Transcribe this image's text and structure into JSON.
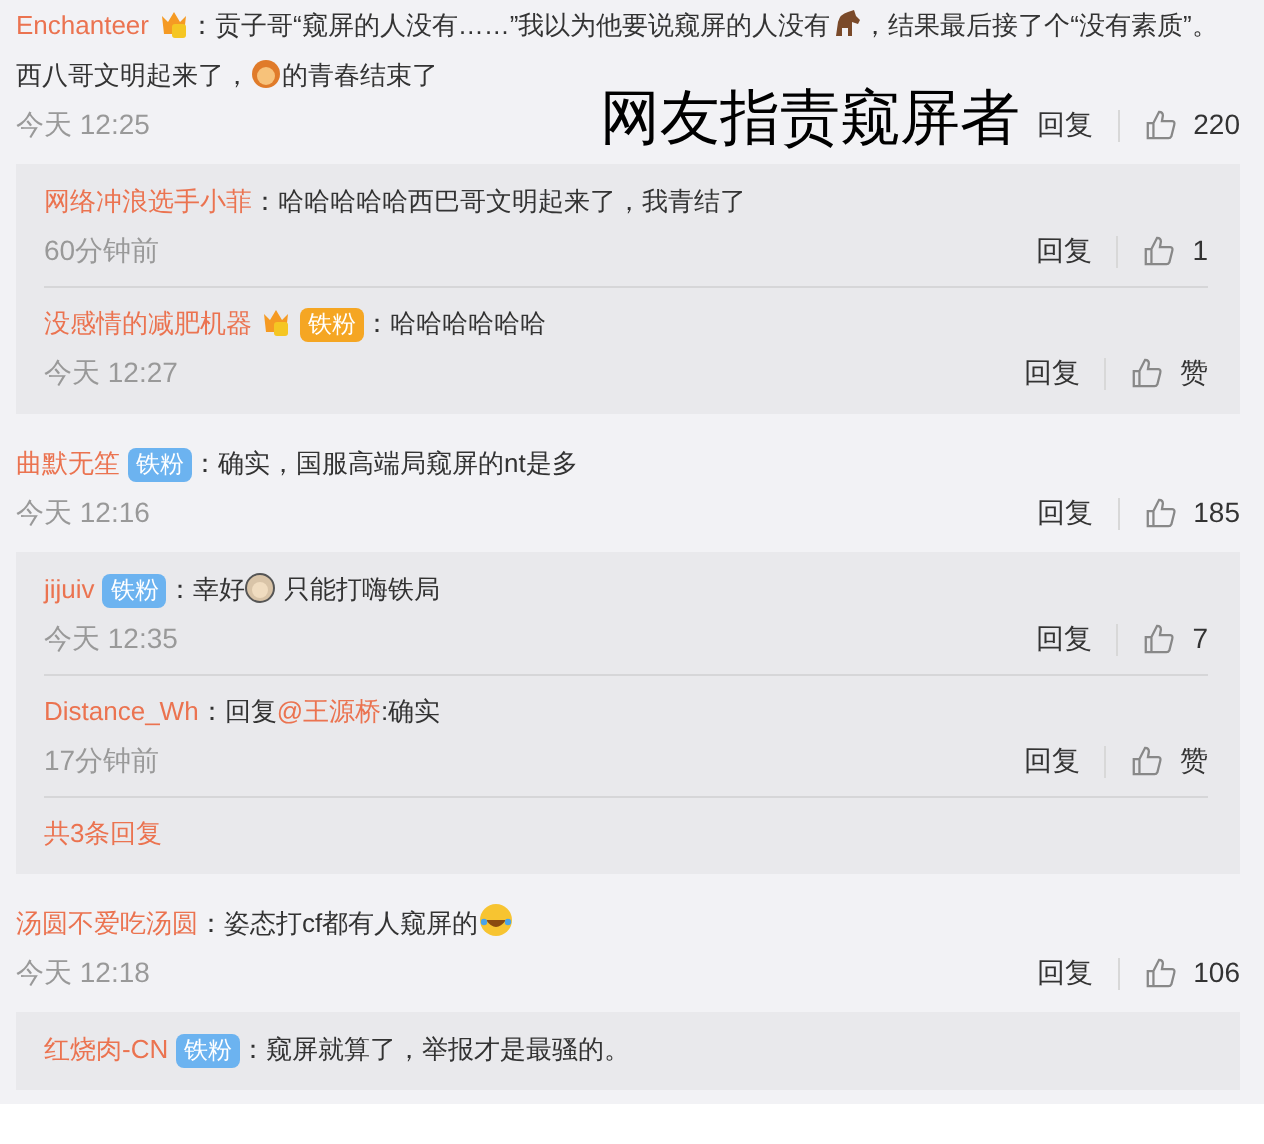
{
  "caption": "网友指责窥屏者",
  "comments": [
    {
      "user": "Enchanteer",
      "badges": [
        {
          "kind": "vip"
        }
      ],
      "parts": [
        {
          "kind": "text",
          "text": "：贡子哥“窥屏的人没有……”我以为他要说窥屏的人没有"
        },
        {
          "kind": "horse"
        },
        {
          "kind": "text",
          "text": "，结果最后接了个“没有素质”。西八哥文明起来了，"
        },
        {
          "kind": "face"
        },
        {
          "kind": "text",
          "text": "的青春结束了"
        }
      ],
      "time": "今天 12:25",
      "reply_label": "回复",
      "likes": "220",
      "replies": [
        {
          "user": "网络冲浪选手小菲",
          "parts": [
            {
              "kind": "text",
              "text": "：哈哈哈哈哈西巴哥文明起来了，我青结了"
            }
          ],
          "time": "60分钟前",
          "reply_label": "回复",
          "likes": "1"
        },
        {
          "user": "没感情的减肥机器",
          "badges": [
            {
              "kind": "vip"
            },
            {
              "kind": "fan",
              "text": "铁粉",
              "color": "#f5a623"
            }
          ],
          "parts": [
            {
              "kind": "text",
              "text": "：哈哈哈哈哈哈"
            }
          ],
          "time": "今天 12:27",
          "reply_label": "回复",
          "likes": "赞"
        }
      ]
    },
    {
      "user": "曲默无笙",
      "badges": [
        {
          "kind": "fan",
          "text": "铁粉",
          "color": "#6cb3f0"
        }
      ],
      "parts": [
        {
          "kind": "text",
          "text": "：确实，国服高端局窥屏的nt是多"
        }
      ],
      "time": "今天 12:16",
      "reply_label": "回复",
      "likes": "185",
      "replies": [
        {
          "user": "jijuiv",
          "badges": [
            {
              "kind": "fan",
              "text": "铁粉",
              "color": "#6cb3f0"
            }
          ],
          "parts": [
            {
              "kind": "text",
              "text": "：幸好"
            },
            {
              "kind": "oldman"
            },
            {
              "kind": "text",
              "text": " 只能打嗨铁局"
            }
          ],
          "time": "今天 12:35",
          "reply_label": "回复",
          "likes": "7"
        },
        {
          "user": "Distance_Wh",
          "parts": [
            {
              "kind": "text",
              "text": "：回复"
            },
            {
              "kind": "mention",
              "text": "@王源桥"
            },
            {
              "kind": "text",
              "text": ":确实"
            }
          ],
          "time": "17分钟前",
          "reply_label": "回复",
          "likes": "赞"
        }
      ],
      "more": "共3条回复"
    },
    {
      "user": "汤圆不爱吃汤圆",
      "parts": [
        {
          "kind": "text",
          "text": "：姿态打cf都有人窥屏的"
        },
        {
          "kind": "laugh"
        }
      ],
      "time": "今天 12:18",
      "reply_label": "回复",
      "likes": "106",
      "replies": [
        {
          "user": "红烧肉-CN",
          "badges": [
            {
              "kind": "fan",
              "text": "铁粉",
              "color": "#6cb3f0"
            }
          ],
          "parts": [
            {
              "kind": "text",
              "text": "：窥屏就算了，举报才是最骚的。"
            }
          ]
        }
      ]
    }
  ]
}
